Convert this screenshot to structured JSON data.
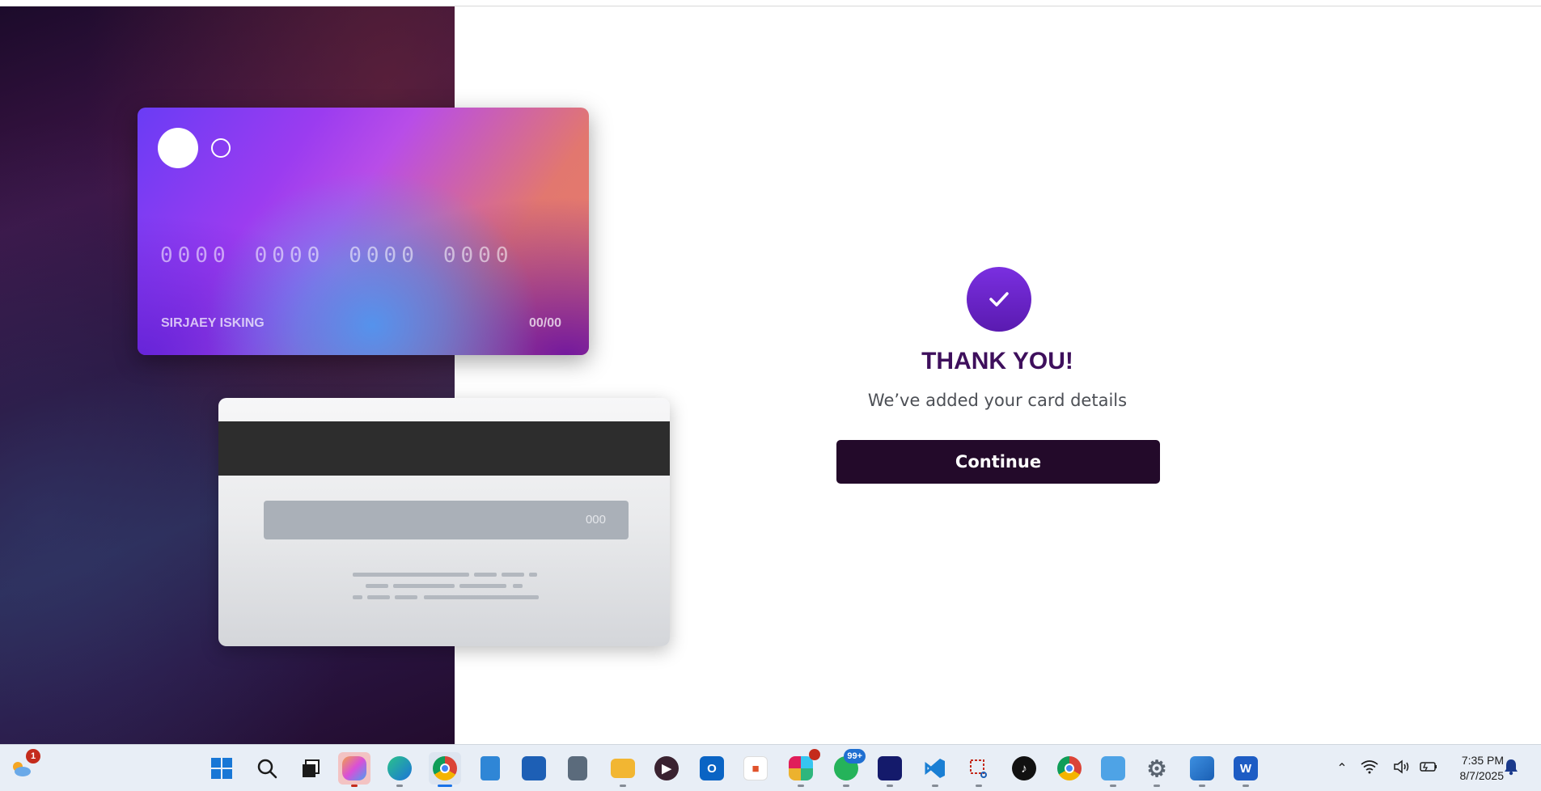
{
  "card_front": {
    "number_groups": [
      "0000",
      "0000",
      "0000",
      "0000"
    ],
    "holder_name": "SIRJAEY ISKING",
    "expiry": "00/00"
  },
  "card_back": {
    "cvv": "000"
  },
  "success": {
    "title": "THANK YOU!",
    "message": "We’ve added your card details",
    "continue_label": "Continue"
  },
  "taskbar": {
    "weather_badge": "1",
    "whatsapp_badge": "99+",
    "apps": [
      {
        "name": "start",
        "icon": "windows-icon"
      },
      {
        "name": "search",
        "icon": "search-icon"
      },
      {
        "name": "task-view",
        "icon": "task-view-icon"
      },
      {
        "name": "copilot",
        "icon": "copilot-icon"
      },
      {
        "name": "edge",
        "icon": "edge-icon"
      },
      {
        "name": "chrome",
        "icon": "chrome-icon"
      },
      {
        "name": "notepad",
        "icon": "notepad-icon"
      },
      {
        "name": "store",
        "icon": "store-icon"
      },
      {
        "name": "calculator",
        "icon": "calculator-icon"
      },
      {
        "name": "file-explorer",
        "icon": "folder-icon"
      },
      {
        "name": "media-player",
        "icon": "play-icon"
      },
      {
        "name": "outlook",
        "icon": "outlook-icon"
      },
      {
        "name": "app",
        "icon": "app-icon"
      },
      {
        "name": "slack",
        "icon": "slack-icon"
      },
      {
        "name": "whatsapp",
        "icon": "whatsapp-icon"
      },
      {
        "name": "efootball",
        "icon": "efootball-icon"
      },
      {
        "name": "vscode",
        "icon": "vscode-icon"
      },
      {
        "name": "snipping-tool",
        "icon": "snipping-icon"
      },
      {
        "name": "tiktok",
        "icon": "tiktok-icon"
      },
      {
        "name": "chrome-profile",
        "icon": "chrome-icon"
      },
      {
        "name": "control-panel",
        "icon": "control-panel-icon"
      },
      {
        "name": "settings",
        "icon": "gear-icon"
      },
      {
        "name": "photos",
        "icon": "photos-icon"
      },
      {
        "name": "word",
        "icon": "word-icon"
      }
    ],
    "clock": {
      "time": "7:35 PM",
      "date": "8/7/2025"
    }
  },
  "colors": {
    "title": "#3e0f5c",
    "button": "#230a2a",
    "check_circle": "#6a24c8"
  }
}
